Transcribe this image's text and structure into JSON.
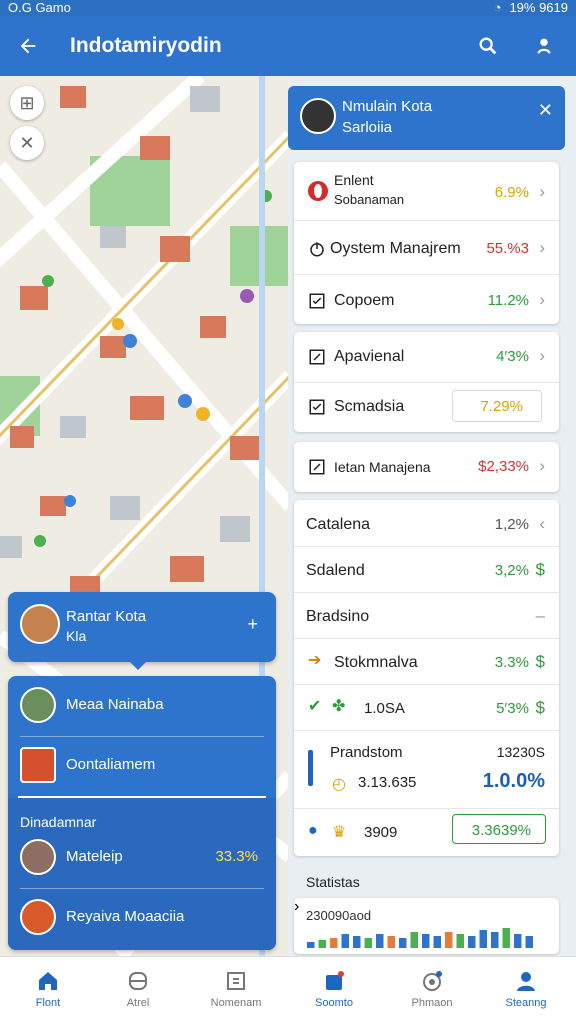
{
  "status_bar": {
    "left": "O.G  Gamo",
    "right": "19%  9619"
  },
  "app_bar": {
    "title": "Indotamiryodin"
  },
  "info_card": {
    "title": "Nmulain Kota",
    "subtitle": "Sarloiia"
  },
  "card1": {
    "rows": [
      {
        "label": "Enlent",
        "sublabel": "Sobanaman",
        "value": "6.9%"
      },
      {
        "label": "Oystem Manajrem",
        "value": "55.%3"
      },
      {
        "label": "Copoem",
        "value": "11.2%"
      }
    ]
  },
  "card2": {
    "rows": [
      {
        "label": "Apavienal",
        "value": "4′3%"
      },
      {
        "label": "Scmadsia",
        "value": "7.29%"
      }
    ]
  },
  "card3": {
    "rows": [
      {
        "label": "Ietan Manajena",
        "value": "$2,33%"
      }
    ]
  },
  "card4": {
    "rows": [
      {
        "label": "Catalena",
        "value": "1,2%"
      },
      {
        "label": "Sdalend",
        "value": "3,2%"
      },
      {
        "label": "Bradsino",
        "value": "–"
      },
      {
        "label": "Stokmnalva",
        "value": "3.3%"
      },
      {
        "label": "1.0SA",
        "value": "5′3%"
      },
      {
        "label": "Prandstom",
        "sub": "3.13.635",
        "value": "13230S",
        "value2": "1.0.0%"
      },
      {
        "label": "3909",
        "value": "3.3639%"
      }
    ]
  },
  "statistics": {
    "title": "Statistas",
    "label": "230090aod"
  },
  "popup1": {
    "title": "Rantar Kota",
    "subtitle": "Kla"
  },
  "popup2": {
    "rows": [
      {
        "label": "Meaa Nainaba"
      },
      {
        "label": "Oontaliamem"
      }
    ],
    "section": "Dinadamnar",
    "rows2": [
      {
        "label": "Mateleip",
        "value": "33.3%"
      },
      {
        "label": "Reyaiva Moaaciia"
      }
    ]
  },
  "bottom_nav": [
    {
      "label": "Flont"
    },
    {
      "label": "Atrel"
    },
    {
      "label": "Nomenam"
    },
    {
      "label": "Soomto"
    },
    {
      "label": "Phmaon"
    },
    {
      "label": "Steanng"
    }
  ],
  "chart_bars": [
    3,
    4,
    5,
    7,
    6,
    5,
    7,
    6,
    5,
    8,
    7,
    6,
    8,
    7,
    6,
    9,
    8,
    10,
    7,
    6
  ]
}
